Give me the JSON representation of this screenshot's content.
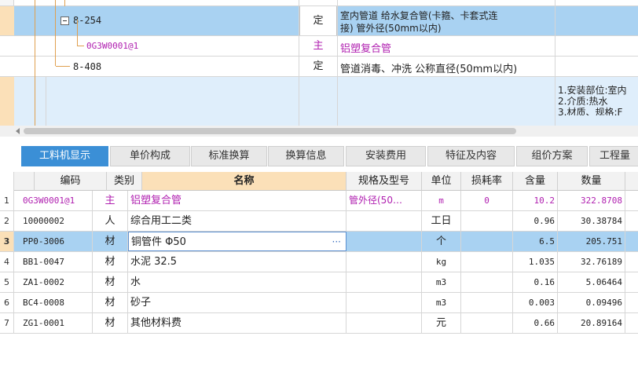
{
  "tree": {
    "rows": [
      {
        "code": "8-254",
        "type": "定",
        "name_line1": "室内管道 给水复合管(卡箍、卡套式连",
        "name_line2": "接) 管外径(50mm以内)"
      },
      {
        "code": "0G3W0001@1",
        "type": "主",
        "name": "铝塑复合管"
      },
      {
        "code": "8-408",
        "type": "定",
        "name": "管道消毒、冲洗 公称直径(50mm以内)"
      }
    ],
    "features": [
      "1.安装部位:室内",
      "2.介质:热水",
      "3.材质、规格:F"
    ]
  },
  "tabs": [
    "工料机显示",
    "单价构成",
    "标准换算",
    "换算信息",
    "安装费用",
    "特征及内容",
    "组价方案",
    "工程量"
  ],
  "table": {
    "headers": {
      "code": "编码",
      "cat": "类别",
      "name": "名称",
      "spec": "规格及型号",
      "unit": "单位",
      "loss": "损耗率",
      "content": "含量",
      "qty": "数量"
    },
    "rows": [
      {
        "no": "1",
        "code": "0G3W0001@1",
        "cat": "主",
        "name": "铝塑复合管",
        "spec": "管外径(50…",
        "unit": "m",
        "loss": "0",
        "content": "10.2",
        "qty": "322.8708"
      },
      {
        "no": "2",
        "code": "10000002",
        "cat": "人",
        "name": "综合用工二类",
        "spec": "",
        "unit": "工日",
        "loss": "",
        "content": "0.96",
        "qty": "30.38784"
      },
      {
        "no": "3",
        "code": "PP0-3006",
        "cat": "材",
        "name": "铜管件 Φ50",
        "spec": "",
        "unit": "个",
        "loss": "",
        "content": "6.5",
        "qty": "205.751"
      },
      {
        "no": "4",
        "code": "BB1-0047",
        "cat": "材",
        "name": "水泥 32.5",
        "spec": "",
        "unit": "kg",
        "loss": "",
        "content": "1.035",
        "qty": "32.76189"
      },
      {
        "no": "5",
        "code": "ZA1-0002",
        "cat": "材",
        "name": "水",
        "spec": "",
        "unit": "m3",
        "loss": "",
        "content": "0.16",
        "qty": "5.06464"
      },
      {
        "no": "6",
        "code": "BC4-0008",
        "cat": "材",
        "name": "砂子",
        "spec": "",
        "unit": "m3",
        "loss": "",
        "content": "0.003",
        "qty": "0.09496"
      },
      {
        "no": "7",
        "code": "ZG1-0001",
        "cat": "材",
        "name": "其他材料费",
        "spec": "",
        "unit": "元",
        "loss": "",
        "content": "0.66",
        "qty": "20.89164"
      }
    ],
    "ellipsis": "···"
  },
  "colors": {
    "selected_row": "#a9d2f2",
    "tab_active": "#3b8fd6",
    "main_material": "#b020b0",
    "tree_line": "#e0a050"
  }
}
